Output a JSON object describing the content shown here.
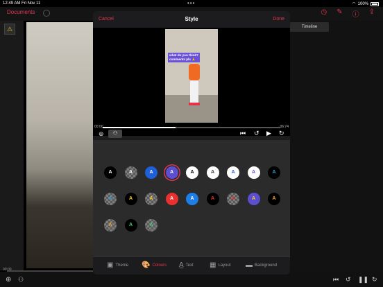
{
  "status": {
    "time": "12:49 AM",
    "date": "Fri Nov 11",
    "battery": "100%"
  },
  "background": {
    "documents_label": "Documents",
    "timeline_tab": "Timeline",
    "timecode_left": "00:00"
  },
  "modal": {
    "cancel_label": "Cancel",
    "title": "Style",
    "done_label": "Done",
    "caption_text": "what do you think? comments pls 🙏",
    "time_start": "00:00",
    "time_end": "06:74",
    "progress": 0.41
  },
  "swatches": [
    {
      "letter": "A",
      "bg": "#000000",
      "fg": "#ffffff"
    },
    {
      "letter": "A",
      "bg": "checker",
      "fg": "#ffffff"
    },
    {
      "letter": "A",
      "bg": "#1f5fd8",
      "fg": "#ffffff"
    },
    {
      "letter": "A",
      "bg": "#5b4fd0",
      "fg": "#ffffff",
      "selected": true
    },
    {
      "letter": "A",
      "bg": "#ffffff",
      "fg": "#000000"
    },
    {
      "letter": "A",
      "bg": "#ffffff",
      "fg": "#333333"
    },
    {
      "letter": "A",
      "bg": "#ffffff",
      "fg": "#1f5fd8"
    },
    {
      "letter": "A",
      "bg": "#ffffff",
      "fg": "#5b4fd0"
    },
    {
      "letter": "A",
      "bg": "#000000",
      "fg": "#39a0e0"
    },
    {
      "letter": "A",
      "bg": "checker",
      "fg": "#39a0e0"
    },
    {
      "letter": "A",
      "bg": "#000000",
      "fg": "#f5d020"
    },
    {
      "letter": "A",
      "bg": "checker",
      "fg": "#f5d020"
    },
    {
      "letter": "A",
      "bg": "#e8312f",
      "fg": "#ffffff"
    },
    {
      "letter": "A",
      "bg": "#1d7ee8",
      "fg": "#ffffff"
    },
    {
      "letter": "A",
      "bg": "#000000",
      "fg": "#e8312f"
    },
    {
      "letter": "A",
      "bg": "checker",
      "fg": "#e8312f"
    },
    {
      "letter": "A",
      "bg": "#5b4fd0",
      "fg": "#f5d020"
    },
    {
      "letter": "A",
      "bg": "#000000",
      "fg": "#f5a623"
    },
    {
      "letter": "A",
      "bg": "checker",
      "fg": "#f5a623"
    },
    {
      "letter": "A",
      "bg": "#000000",
      "fg": "#3ed07a"
    },
    {
      "letter": "A",
      "bg": "checker",
      "fg": "#3ed07a"
    }
  ],
  "tabs": [
    {
      "label": "Theme",
      "icon": "theme-icon",
      "active": false
    },
    {
      "label": "Colours",
      "icon": "palette-icon",
      "active": true
    },
    {
      "label": "Text",
      "icon": "text-icon",
      "active": false
    },
    {
      "label": "Layout",
      "icon": "layout-icon",
      "active": false
    },
    {
      "label": "Background",
      "icon": "background-icon",
      "active": false
    }
  ],
  "colors": {
    "accent": "#e0374f"
  }
}
